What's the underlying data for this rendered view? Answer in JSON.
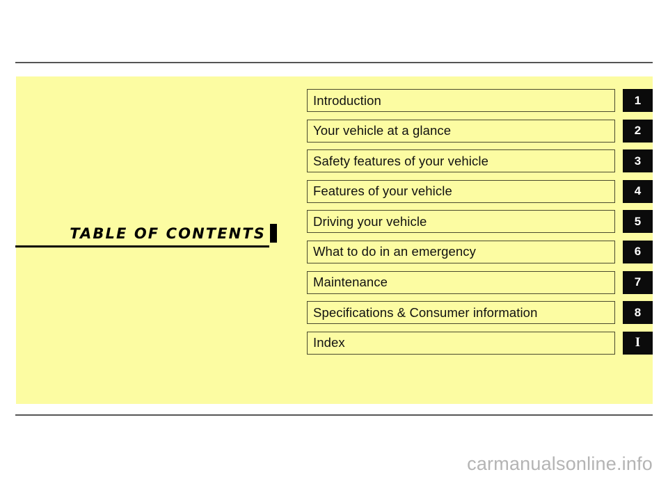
{
  "page": {
    "background_color": "#ffffff",
    "panel_color": "#fcfca2",
    "rule_color": "#555555",
    "badge_color": "#0b0b0b",
    "badge_text_color": "#ffffff",
    "watermark": "carmanualsonline.info",
    "watermark_color": "#b4b4b4"
  },
  "title": {
    "text": "TABLE  OF  CONTENTS"
  },
  "toc": {
    "rows": [
      {
        "label": "Introduction",
        "badge": "1"
      },
      {
        "label": "Your vehicle at a glance",
        "badge": "2"
      },
      {
        "label": "Safety features of your vehicle",
        "badge": "3"
      },
      {
        "label": "Features of your vehicle",
        "badge": "4"
      },
      {
        "label": "Driving your vehicle",
        "badge": "5"
      },
      {
        "label": "What to do in an emergency",
        "badge": "6"
      },
      {
        "label": "Maintenance",
        "badge": "7"
      },
      {
        "label": "Specifications & Consumer information",
        "badge": "8"
      },
      {
        "label": "Index",
        "badge": "I"
      }
    ]
  }
}
